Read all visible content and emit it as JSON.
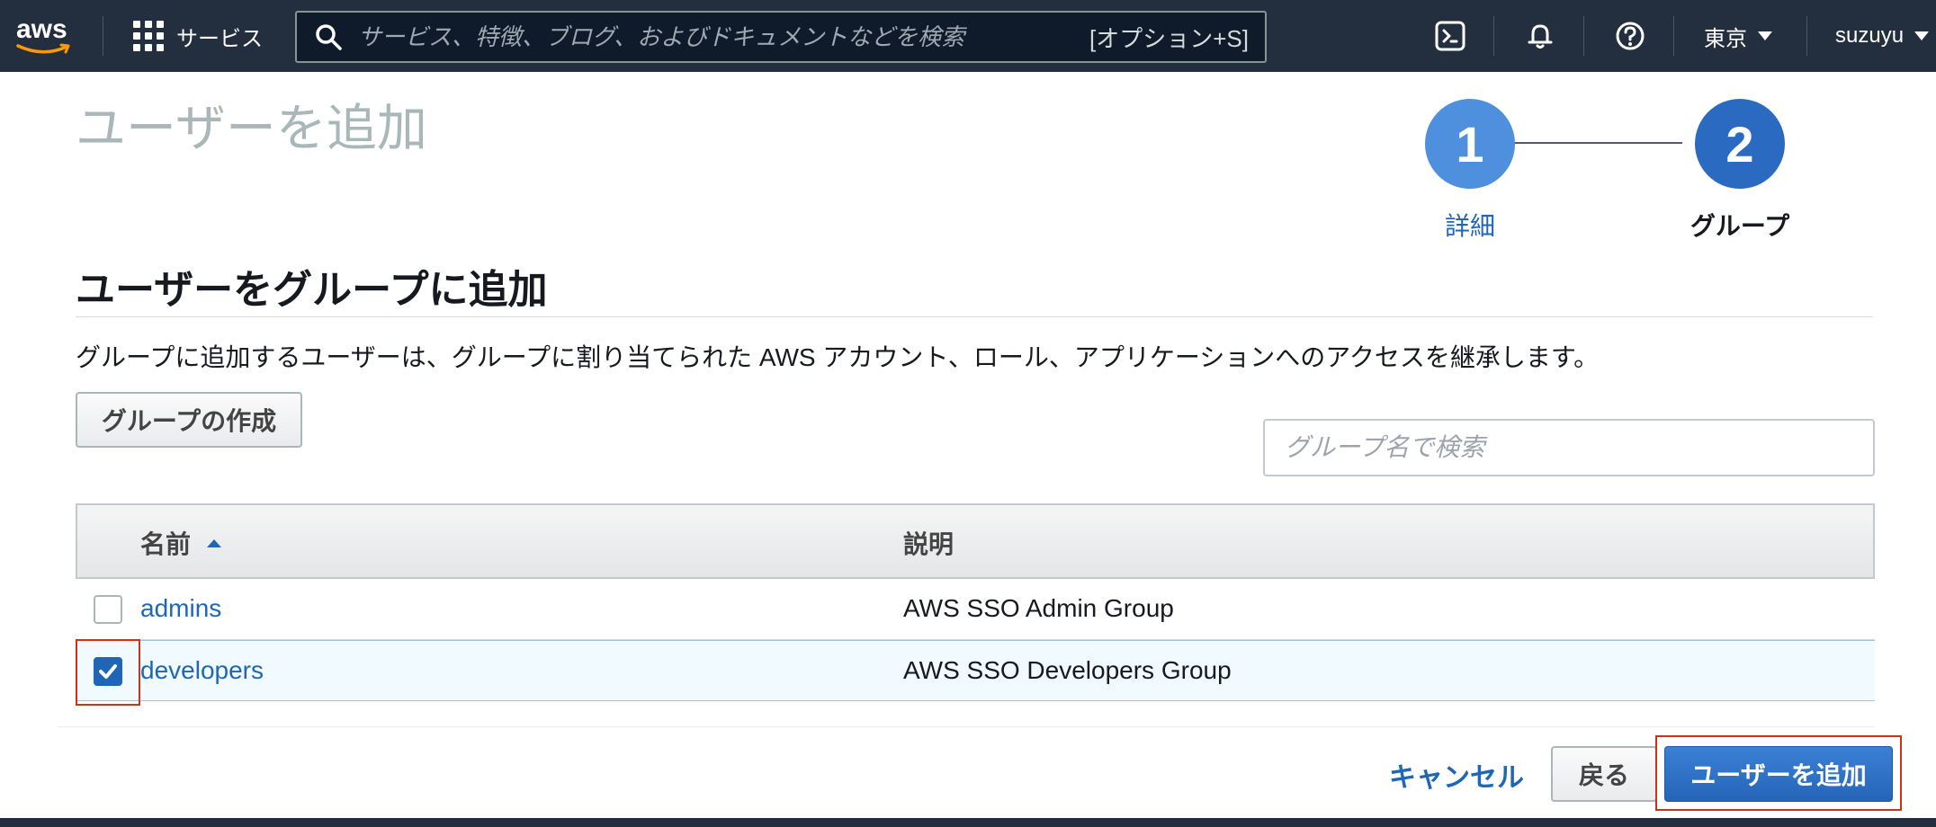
{
  "topbar": {
    "logo_text": "aws",
    "services_label": "サービス",
    "search_placeholder": "サービス、特徴、ブログ、およびドキュメントなどを検索",
    "search_shortcut": "[オプション+S]",
    "region_label": "東京",
    "user_label": "suzuyu",
    "icons": [
      "cloudshell-icon",
      "bell-icon",
      "help-icon"
    ]
  },
  "page": {
    "title": "ユーザーを追加"
  },
  "stepper": {
    "steps": [
      {
        "number": "1",
        "label": "詳細"
      },
      {
        "number": "2",
        "label": "グループ"
      }
    ],
    "current_step": 2
  },
  "section": {
    "heading": "ユーザーをグループに追加",
    "description": "グループに追加するユーザーは、グループに割り当てられた AWS アカウント、ロール、アプリケーションへのアクセスを継承します。",
    "create_group_label": "グループの作成",
    "search_placeholder": "グループ名で検索"
  },
  "table": {
    "columns": [
      "名前",
      "説明"
    ],
    "rows": [
      {
        "name": "admins",
        "description": "AWS SSO Admin Group",
        "checked": false
      },
      {
        "name": "developers",
        "description": "AWS SSO Developers Group",
        "checked": true
      }
    ]
  },
  "footer": {
    "cancel_label": "キャンセル",
    "back_label": "戻る",
    "submit_label": "ユーザーを追加"
  },
  "colors": {
    "topbar_bg": "#232f3e",
    "link": "#1f67b6",
    "primary": "#2b6ac1",
    "highlight": "#d13212"
  }
}
